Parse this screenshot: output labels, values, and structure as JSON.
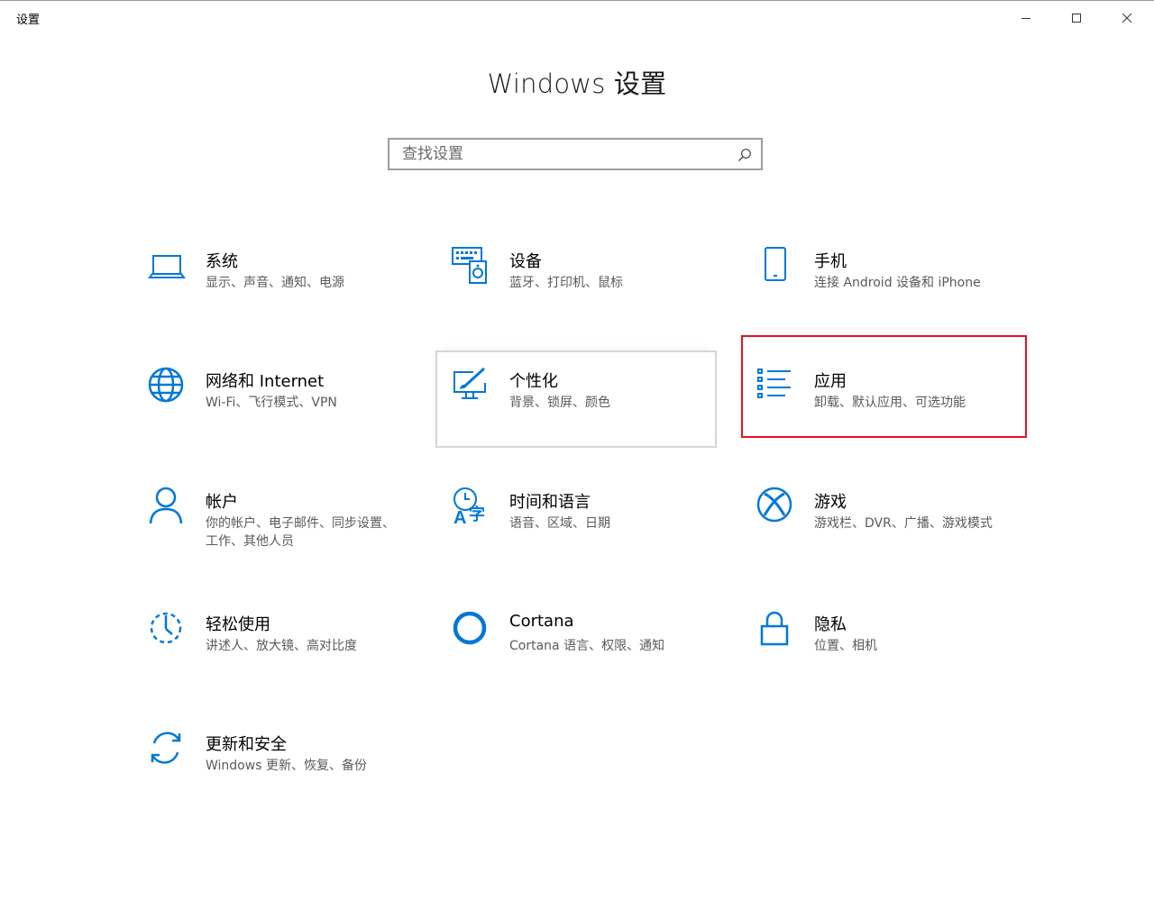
{
  "window": {
    "title": "设置",
    "controls": {
      "minimize_icon": "minimize-icon",
      "maximize_icon": "maximize-icon",
      "close_icon": "close-icon"
    }
  },
  "header": {
    "title": "Windows 设置"
  },
  "search": {
    "placeholder": "查找设置",
    "value": "",
    "icon": "search-icon"
  },
  "accent_color": "#0078d7",
  "highlight_color": "#e81123",
  "tiles": [
    {
      "id": "system",
      "icon": "laptop-icon",
      "title": "系统",
      "desc": "显示、声音、通知、电源"
    },
    {
      "id": "devices",
      "icon": "devices-icon",
      "title": "设备",
      "desc": "蓝牙、打印机、鼠标"
    },
    {
      "id": "phone",
      "icon": "phone-icon",
      "title": "手机",
      "desc": "连接 Android 设备和 iPhone"
    },
    {
      "id": "network",
      "icon": "globe-icon",
      "title": "网络和 Internet",
      "desc": "Wi-Fi、飞行模式、VPN"
    },
    {
      "id": "personalization",
      "icon": "personalization-icon",
      "title": "个性化",
      "desc": "背景、锁屏、颜色",
      "state": "hovered"
    },
    {
      "id": "apps",
      "icon": "apps-list-icon",
      "title": "应用",
      "desc": "卸载、默认应用、可选功能",
      "state": "highlighted"
    },
    {
      "id": "accounts",
      "icon": "person-icon",
      "title": "帐户",
      "desc": "你的帐户、电子邮件、同步设置、工作、其他人员"
    },
    {
      "id": "time-language",
      "icon": "time-language-icon",
      "title": "时间和语言",
      "desc": "语音、区域、日期"
    },
    {
      "id": "gaming",
      "icon": "xbox-icon",
      "title": "游戏",
      "desc": "游戏栏、DVR、广播、游戏模式"
    },
    {
      "id": "ease-of-access",
      "icon": "ease-of-access-icon",
      "title": "轻松使用",
      "desc": "讲述人、放大镜、高对比度"
    },
    {
      "id": "cortana",
      "icon": "cortana-icon",
      "title": "Cortana",
      "desc": "Cortana 语言、权限、通知"
    },
    {
      "id": "privacy",
      "icon": "lock-icon",
      "title": "隐私",
      "desc": "位置、相机"
    },
    {
      "id": "update-security",
      "icon": "sync-icon",
      "title": "更新和安全",
      "desc": "Windows 更新、恢复、备份"
    }
  ]
}
